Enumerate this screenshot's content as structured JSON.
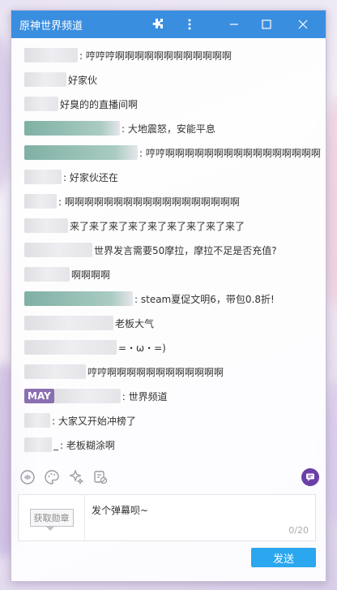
{
  "window": {
    "title": "原神世界频道"
  },
  "messages": [
    {
      "text": ": 哼哼哼啊啊啊啊啊啊啊啊啊啊啊啊"
    },
    {
      "text": "好家伙"
    },
    {
      "text": "好臭的的直播间啊"
    },
    {
      "text": ": 大地震怒，安能平息"
    },
    {
      "text": ": 哼哼啊啊啊啊啊啊啊啊啊啊啊啊啊啊啊啊"
    },
    {
      "text": ": 好家伙还在"
    },
    {
      "text": ": 啊啊啊啊啊啊啊啊啊啊啊啊啊啊啊啊啊啊"
    },
    {
      "text": "来了来了来了来了来了来了来了来了来了"
    },
    {
      "text": "世界发言需要50摩拉，摩拉不足是否充值?"
    },
    {
      "text": "啊啊啊啊"
    },
    {
      "text": ": steam夏促文明6，带包0.8折!"
    },
    {
      "text": "老板大气"
    },
    {
      "text": "=・ω・=)"
    },
    {
      "text": "哼哼啊啊啊啊啊啊啊啊啊啊啊啊"
    },
    {
      "badge": "MAY",
      "text": ": 世界频道"
    },
    {
      "text": ": 大家又开始冲榜了"
    },
    {
      "namefrag": "_",
      "text": ": 老板糊涂啊"
    }
  ],
  "input": {
    "medal": "获取勋章",
    "placeholder": "发个弹幕呗~",
    "counter": "0/20"
  },
  "send": {
    "label": "发送"
  },
  "colors": {
    "titlebar": "#3a8ee0",
    "send": "#2aa7ef",
    "badge": "#8b6fb0"
  }
}
